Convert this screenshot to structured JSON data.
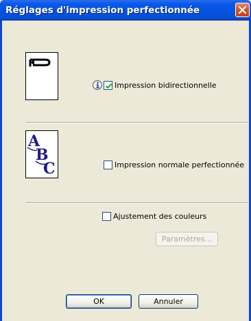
{
  "window": {
    "title": "Réglages d'impression perfectionnée"
  },
  "options": {
    "bidirectional": {
      "label": "Impression bidirectionnelle",
      "checked": true
    },
    "enhanced_normal": {
      "label": "Impression normale perfectionnée",
      "checked": false
    },
    "color_adjust": {
      "label": "Ajustement des couleurs",
      "checked": false
    }
  },
  "buttons": {
    "parameters": "Paramètres...",
    "ok": "OK",
    "cancel": "Annuler"
  },
  "icons": {
    "info": "info-icon",
    "close": "close-icon",
    "bidirectional_preview": "bidirectional-arrow-icon",
    "abc_preview": "abc-text-icon"
  },
  "colors": {
    "titlebar": "#0353e1",
    "dialog_bg": "#ece9d8",
    "close_btn": "#d9542a",
    "abc_text": "#1a1a8c"
  }
}
